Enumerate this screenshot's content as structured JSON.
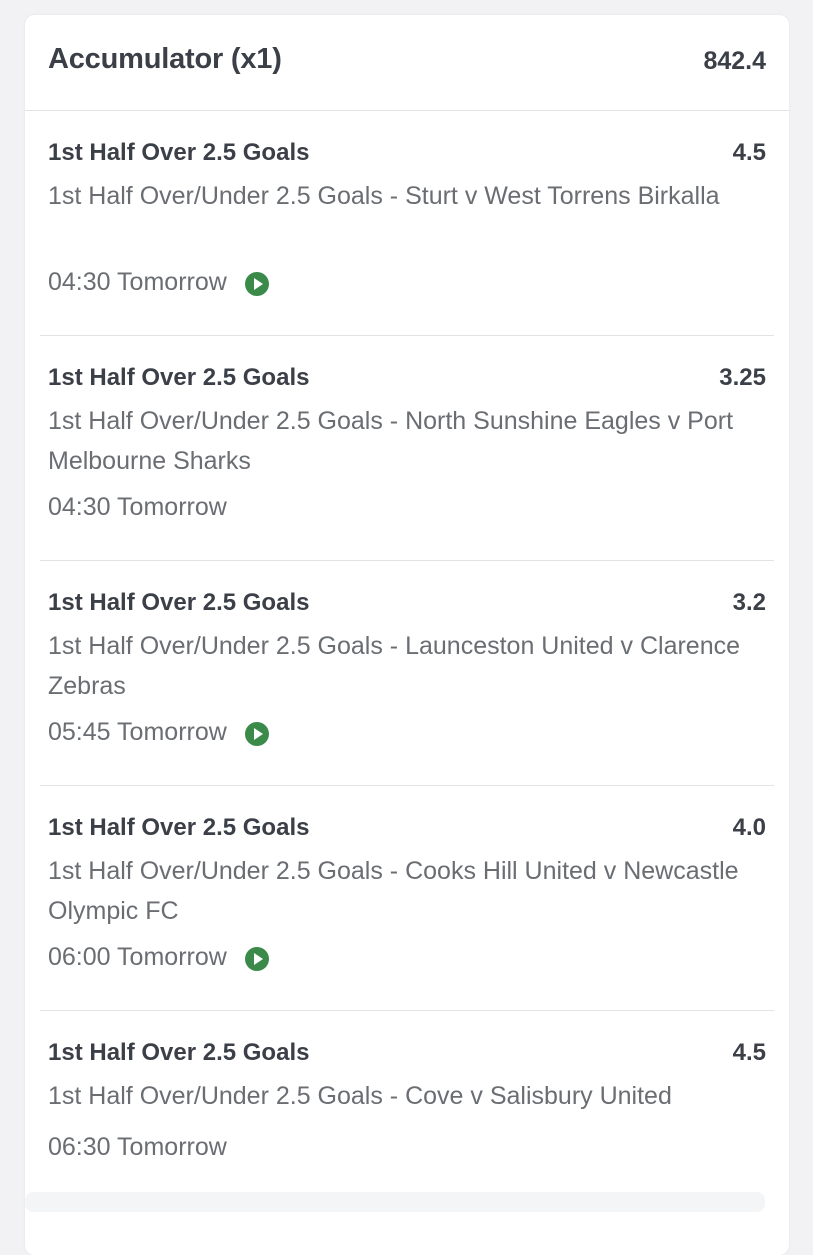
{
  "header": {
    "title": "Accumulator (x1)",
    "total_odds": "842.4"
  },
  "colors": {
    "text_dark": "#3b3f47",
    "text_muted": "#6a6d72",
    "live_icon": "#3c8a4a",
    "divider": "#e3e3e3"
  },
  "selections": [
    {
      "title": "1st Half Over 2.5 Goals",
      "odds": "4.5",
      "description": "1st Half Over/Under 2.5 Goals - Sturt v West Torrens Birkalla",
      "time": "04:30 Tomorrow",
      "live_stream": true,
      "icon": "play-circle-icon"
    },
    {
      "title": "1st Half Over 2.5 Goals",
      "odds": "3.25",
      "description": "1st Half Over/Under 2.5 Goals - North Sunshine Eagles v Port Melbourne Sharks",
      "time": "04:30 Tomorrow",
      "live_stream": false
    },
    {
      "title": "1st Half Over 2.5 Goals",
      "odds": "3.2",
      "description": "1st Half Over/Under 2.5 Goals - Launceston United v Clarence Zebras",
      "time": "05:45 Tomorrow",
      "live_stream": true,
      "icon": "play-circle-icon"
    },
    {
      "title": "1st Half Over 2.5 Goals",
      "odds": "4.0",
      "description": "1st Half Over/Under 2.5 Goals - Cooks Hill United v Newcastle Olympic FC",
      "time": "06:00 Tomorrow",
      "live_stream": true,
      "icon": "play-circle-icon"
    },
    {
      "title": "1st Half Over 2.5 Goals",
      "odds": "4.5",
      "description": "1st Half Over/Under 2.5 Goals - Cove v Salisbury United",
      "time": "06:30 Tomorrow",
      "live_stream": false
    }
  ]
}
